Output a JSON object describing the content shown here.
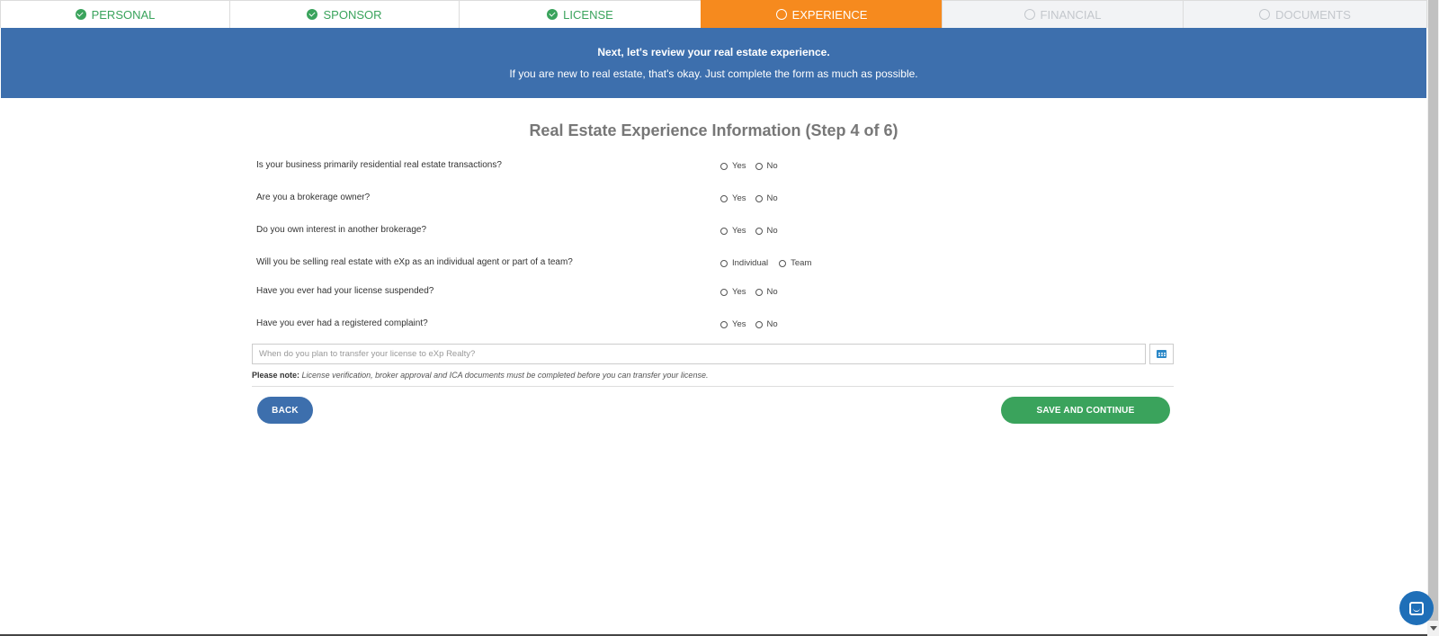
{
  "steps": [
    {
      "label": "PERSONAL",
      "state": "done"
    },
    {
      "label": "SPONSOR",
      "state": "done"
    },
    {
      "label": "LICENSE",
      "state": "done"
    },
    {
      "label": "EXPERIENCE",
      "state": "active"
    },
    {
      "label": "FINANCIAL",
      "state": "todo"
    },
    {
      "label": "DOCUMENTS",
      "state": "todo"
    }
  ],
  "banner": {
    "line1": "Next, let's review your real estate experience.",
    "line2": "If you are new to real estate, that's okay. Just complete the form as much as possible."
  },
  "title": "Real Estate Experience Information (Step 4 of 6)",
  "questions": [
    {
      "text": "Is your business primarily residential real estate transactions?",
      "options": [
        "Yes",
        "No"
      ]
    },
    {
      "text": "Are you a brokerage owner?",
      "options": [
        "Yes",
        "No"
      ]
    },
    {
      "text": "Do you own interest in another brokerage?",
      "options": [
        "Yes",
        "No"
      ]
    },
    {
      "text": "Will you be selling real estate with eXp as an individual agent or part of a team?",
      "options": [
        "Individual",
        "Team"
      ]
    },
    {
      "text": "Have you ever had your license suspended?",
      "options": [
        "Yes",
        "No"
      ]
    },
    {
      "text": "Have you ever had a registered complaint?",
      "options": [
        "Yes",
        "No"
      ]
    }
  ],
  "transfer_date": {
    "placeholder": "When do you plan to transfer your license to eXp Realty?",
    "value": ""
  },
  "note": {
    "label": "Please note:",
    "text": "License verification, broker approval and ICA documents must be completed before you can transfer your license."
  },
  "buttons": {
    "back": "BACK",
    "save": "SAVE AND CONTINUE"
  },
  "colors": {
    "done": "#3aa35c",
    "active": "#f68a1e",
    "banner": "#3d6fad",
    "save": "#3aa35c"
  }
}
